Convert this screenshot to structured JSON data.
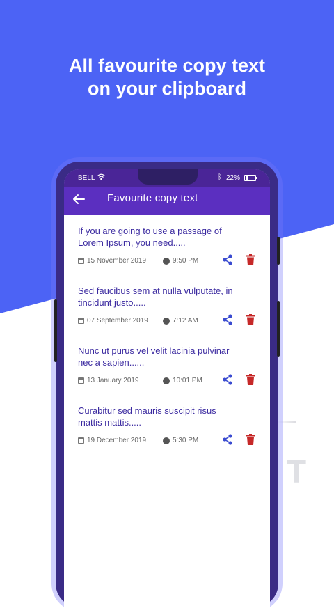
{
  "headline": {
    "line1": "All favourite copy text",
    "line2": "on your clipboard"
  },
  "status_bar": {
    "carrier": "BELL",
    "battery": "22%",
    "bluetooth_icon": "bluetooth-icon",
    "wifi_icon": "wifi-icon"
  },
  "toolbar": {
    "title": "Favourite copy text",
    "back_icon": "arrow-left-icon"
  },
  "items": [
    {
      "text": "If you are going to use a passage of Lorem Ipsum, you need.....",
      "date": "15 November 2019",
      "time": "9:50 PM"
    },
    {
      "text": "Sed faucibus sem at nulla vulputate, in tincidunt justo.....",
      "date": "07 September 2019",
      "time": "7:12 AM"
    },
    {
      "text": "Nunc ut purus vel velit lacinia pulvinar nec a sapien......",
      "date": "13 January 2019",
      "time": "10:01 PM"
    },
    {
      "text": "Curabitur sed mauris suscipit risus mattis mattis.....",
      "date": "19 December 2019",
      "time": "5:30 PM"
    }
  ],
  "decoration": {
    "letter": "T"
  },
  "colors": {
    "background_blue": "#4c63f5",
    "toolbar_purple": "#5b2fc0",
    "item_text": "#3b2aa0",
    "share_blue": "#3a4bd0",
    "delete_red": "#c62828"
  }
}
